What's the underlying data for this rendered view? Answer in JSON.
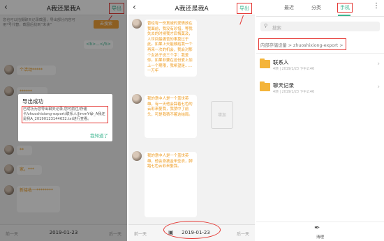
{
  "panel1": {
    "title": "A我还是我A",
    "export_label": "导出",
    "notice": "您也可以拍摄聊天记录截图，导出部分内容可用*号代替，截图后找到“未读”",
    "search_placeholder": "去搜索",
    "tag": "<b>...</b>",
    "messages": [
      "个活动*****",
      "******",
      "**",
      "家。***",
      "新接收一********"
    ],
    "dialog": {
      "title": "导出成功",
      "body": "已成功为您导出聊天记录,您可前往/存储卡/zhuoshixiong-export/联系人/JimmY😂_A我还是我A_20190123144632.txt进行查看。",
      "ok": "我知道了"
    },
    "bottom": {
      "prev": "前一天",
      "date": "2019-01-23",
      "next": "后一天"
    }
  },
  "panel2": {
    "title": "A我还是我A",
    "export_label": "导出",
    "messages": [
      "曾经有一份真诚的爱情放在我面前，我没有珍惜，等我失去的时候我才后悔莫及，人世间最痛苦的事莫过于此。如果上天能够给我一个再来一次的机会，我会对那个女孩子说三个字：我爱你。如果非要在这份爱上加上一个期限，我希望是……一万年",
      "我的意中人是一个盖世英雄，有一天他会踩着七色的云彩来娶我，我猜中了前头，可是我猜不着这结局。",
      "我的意中人是一个盖世英雄，他会身披金甲圣衣，脚踏七色云彩来娶我。"
    ],
    "side_label": "增加",
    "bottom": {
      "prev": "前一天",
      "date": "2019-01-23",
      "next": "后一天"
    }
  },
  "panel3": {
    "tabs": [
      "最近",
      "分类",
      "手机"
    ],
    "active_tab": 2,
    "more_icon": "more-vertical-icon",
    "search_placeholder": "搜索",
    "path": "内部存储设备 > zhuoshixiong-export >",
    "folders": [
      {
        "name": "联系人",
        "meta": "4项 | 2019/1/23 下午2:46"
      },
      {
        "name": "聊天记录",
        "meta": "4项 | 2019/1/23 下午2:46"
      }
    ],
    "clean_label": "清理"
  },
  "colors": {
    "accent": "#3bb58f",
    "bubble_text": "#ee9a1d",
    "highlight": "#e53935",
    "folder": "#f4b43a"
  }
}
